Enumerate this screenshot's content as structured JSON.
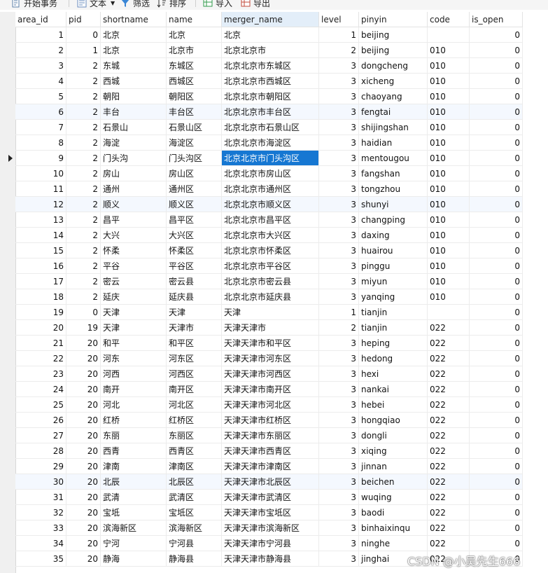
{
  "toolbar": {
    "items": [
      {
        "label": "开始事务",
        "icon": "begin-transaction-icon"
      },
      {
        "label": "文本",
        "icon": "text-view-icon",
        "dropdown": true
      },
      {
        "label": "筛选",
        "icon": "filter-icon"
      },
      {
        "label": "排序",
        "icon": "sort-icon"
      },
      {
        "label": "导入",
        "icon": "import-icon"
      },
      {
        "label": "导出",
        "icon": "export-icon"
      }
    ]
  },
  "columns": [
    "area_id",
    "pid",
    "shortname",
    "name",
    "merger_name",
    "level",
    "pinyin",
    "code",
    "is_open"
  ],
  "selected_column": "merger_name",
  "current_row_id": 9,
  "selected_cell": {
    "row_id": 9,
    "column": "merger_name"
  },
  "rows": [
    [
      1,
      0,
      "北京",
      "北京",
      "北京",
      1,
      "beijing",
      "",
      0
    ],
    [
      2,
      1,
      "北京",
      "北京市",
      "北京北京市",
      2,
      "beijing",
      "010",
      0
    ],
    [
      3,
      2,
      "东城",
      "东城区",
      "北京北京市东城区",
      3,
      "dongcheng",
      "010",
      0
    ],
    [
      4,
      2,
      "西城",
      "西城区",
      "北京北京市西城区",
      3,
      "xicheng",
      "010",
      0
    ],
    [
      5,
      2,
      "朝阳",
      "朝阳区",
      "北京北京市朝阳区",
      3,
      "chaoyang",
      "010",
      0
    ],
    [
      6,
      2,
      "丰台",
      "丰台区",
      "北京北京市丰台区",
      3,
      "fengtai",
      "010",
      0
    ],
    [
      7,
      2,
      "石景山",
      "石景山区",
      "北京北京市石景山区",
      3,
      "shijingshan",
      "010",
      0
    ],
    [
      8,
      2,
      "海淀",
      "海淀区",
      "北京北京市海淀区",
      3,
      "haidian",
      "010",
      0
    ],
    [
      9,
      2,
      "门头沟",
      "门头沟区",
      "北京北京市门头沟区",
      3,
      "mentougou",
      "010",
      0
    ],
    [
      10,
      2,
      "房山",
      "房山区",
      "北京北京市房山区",
      3,
      "fangshan",
      "010",
      0
    ],
    [
      11,
      2,
      "通州",
      "通州区",
      "北京北京市通州区",
      3,
      "tongzhou",
      "010",
      0
    ],
    [
      12,
      2,
      "顺义",
      "顺义区",
      "北京北京市顺义区",
      3,
      "shunyi",
      "010",
      0
    ],
    [
      13,
      2,
      "昌平",
      "昌平区",
      "北京北京市昌平区",
      3,
      "changping",
      "010",
      0
    ],
    [
      14,
      2,
      "大兴",
      "大兴区",
      "北京北京市大兴区",
      3,
      "daxing",
      "010",
      0
    ],
    [
      15,
      2,
      "怀柔",
      "怀柔区",
      "北京北京市怀柔区",
      3,
      "huairou",
      "010",
      0
    ],
    [
      16,
      2,
      "平谷",
      "平谷区",
      "北京北京市平谷区",
      3,
      "pinggu",
      "010",
      0
    ],
    [
      17,
      2,
      "密云",
      "密云县",
      "北京北京市密云县",
      3,
      "miyun",
      "010",
      0
    ],
    [
      18,
      2,
      "延庆",
      "延庆县",
      "北京北京市延庆县",
      3,
      "yanqing",
      "010",
      0
    ],
    [
      19,
      0,
      "天津",
      "天津",
      "天津",
      1,
      "tianjin",
      "",
      0
    ],
    [
      20,
      19,
      "天津",
      "天津市",
      "天津天津市",
      2,
      "tianjin",
      "022",
      0
    ],
    [
      21,
      20,
      "和平",
      "和平区",
      "天津天津市和平区",
      3,
      "heping",
      "022",
      0
    ],
    [
      22,
      20,
      "河东",
      "河东区",
      "天津天津市河东区",
      3,
      "hedong",
      "022",
      0
    ],
    [
      23,
      20,
      "河西",
      "河西区",
      "天津天津市河西区",
      3,
      "hexi",
      "022",
      0
    ],
    [
      24,
      20,
      "南开",
      "南开区",
      "天津天津市南开区",
      3,
      "nankai",
      "022",
      0
    ],
    [
      25,
      20,
      "河北",
      "河北区",
      "天津天津市河北区",
      3,
      "hebei",
      "022",
      0
    ],
    [
      26,
      20,
      "红桥",
      "红桥区",
      "天津天津市红桥区",
      3,
      "hongqiao",
      "022",
      0
    ],
    [
      27,
      20,
      "东丽",
      "东丽区",
      "天津天津市东丽区",
      3,
      "dongli",
      "022",
      0
    ],
    [
      28,
      20,
      "西青",
      "西青区",
      "天津天津市西青区",
      3,
      "xiqing",
      "022",
      0
    ],
    [
      29,
      20,
      "津南",
      "津南区",
      "天津天津市津南区",
      3,
      "jinnan",
      "022",
      0
    ],
    [
      30,
      20,
      "北辰",
      "北辰区",
      "天津天津市北辰区",
      3,
      "beichen",
      "022",
      0
    ],
    [
      31,
      20,
      "武清",
      "武清区",
      "天津天津市武清区",
      3,
      "wuqing",
      "022",
      0
    ],
    [
      32,
      20,
      "宝坻",
      "宝坻区",
      "天津天津市宝坻区",
      3,
      "baodi",
      "022",
      0
    ],
    [
      33,
      20,
      "滨海新区",
      "滨海新区",
      "天津天津市滨海新区",
      3,
      "binhaixinqu",
      "022",
      0
    ],
    [
      34,
      20,
      "宁河",
      "宁河县",
      "天津天津市宁河县",
      3,
      "ninghe",
      "022",
      0
    ],
    [
      35,
      20,
      "静海",
      "静海县",
      "天津天津市静海县",
      3,
      "jinghai",
      "022",
      0
    ]
  ],
  "watermark": "CSDN @小吴先生666",
  "colors": {
    "selection": "#1677d2",
    "header_selected": "#e3eef9",
    "row_alt": "#f4f8fe"
  }
}
